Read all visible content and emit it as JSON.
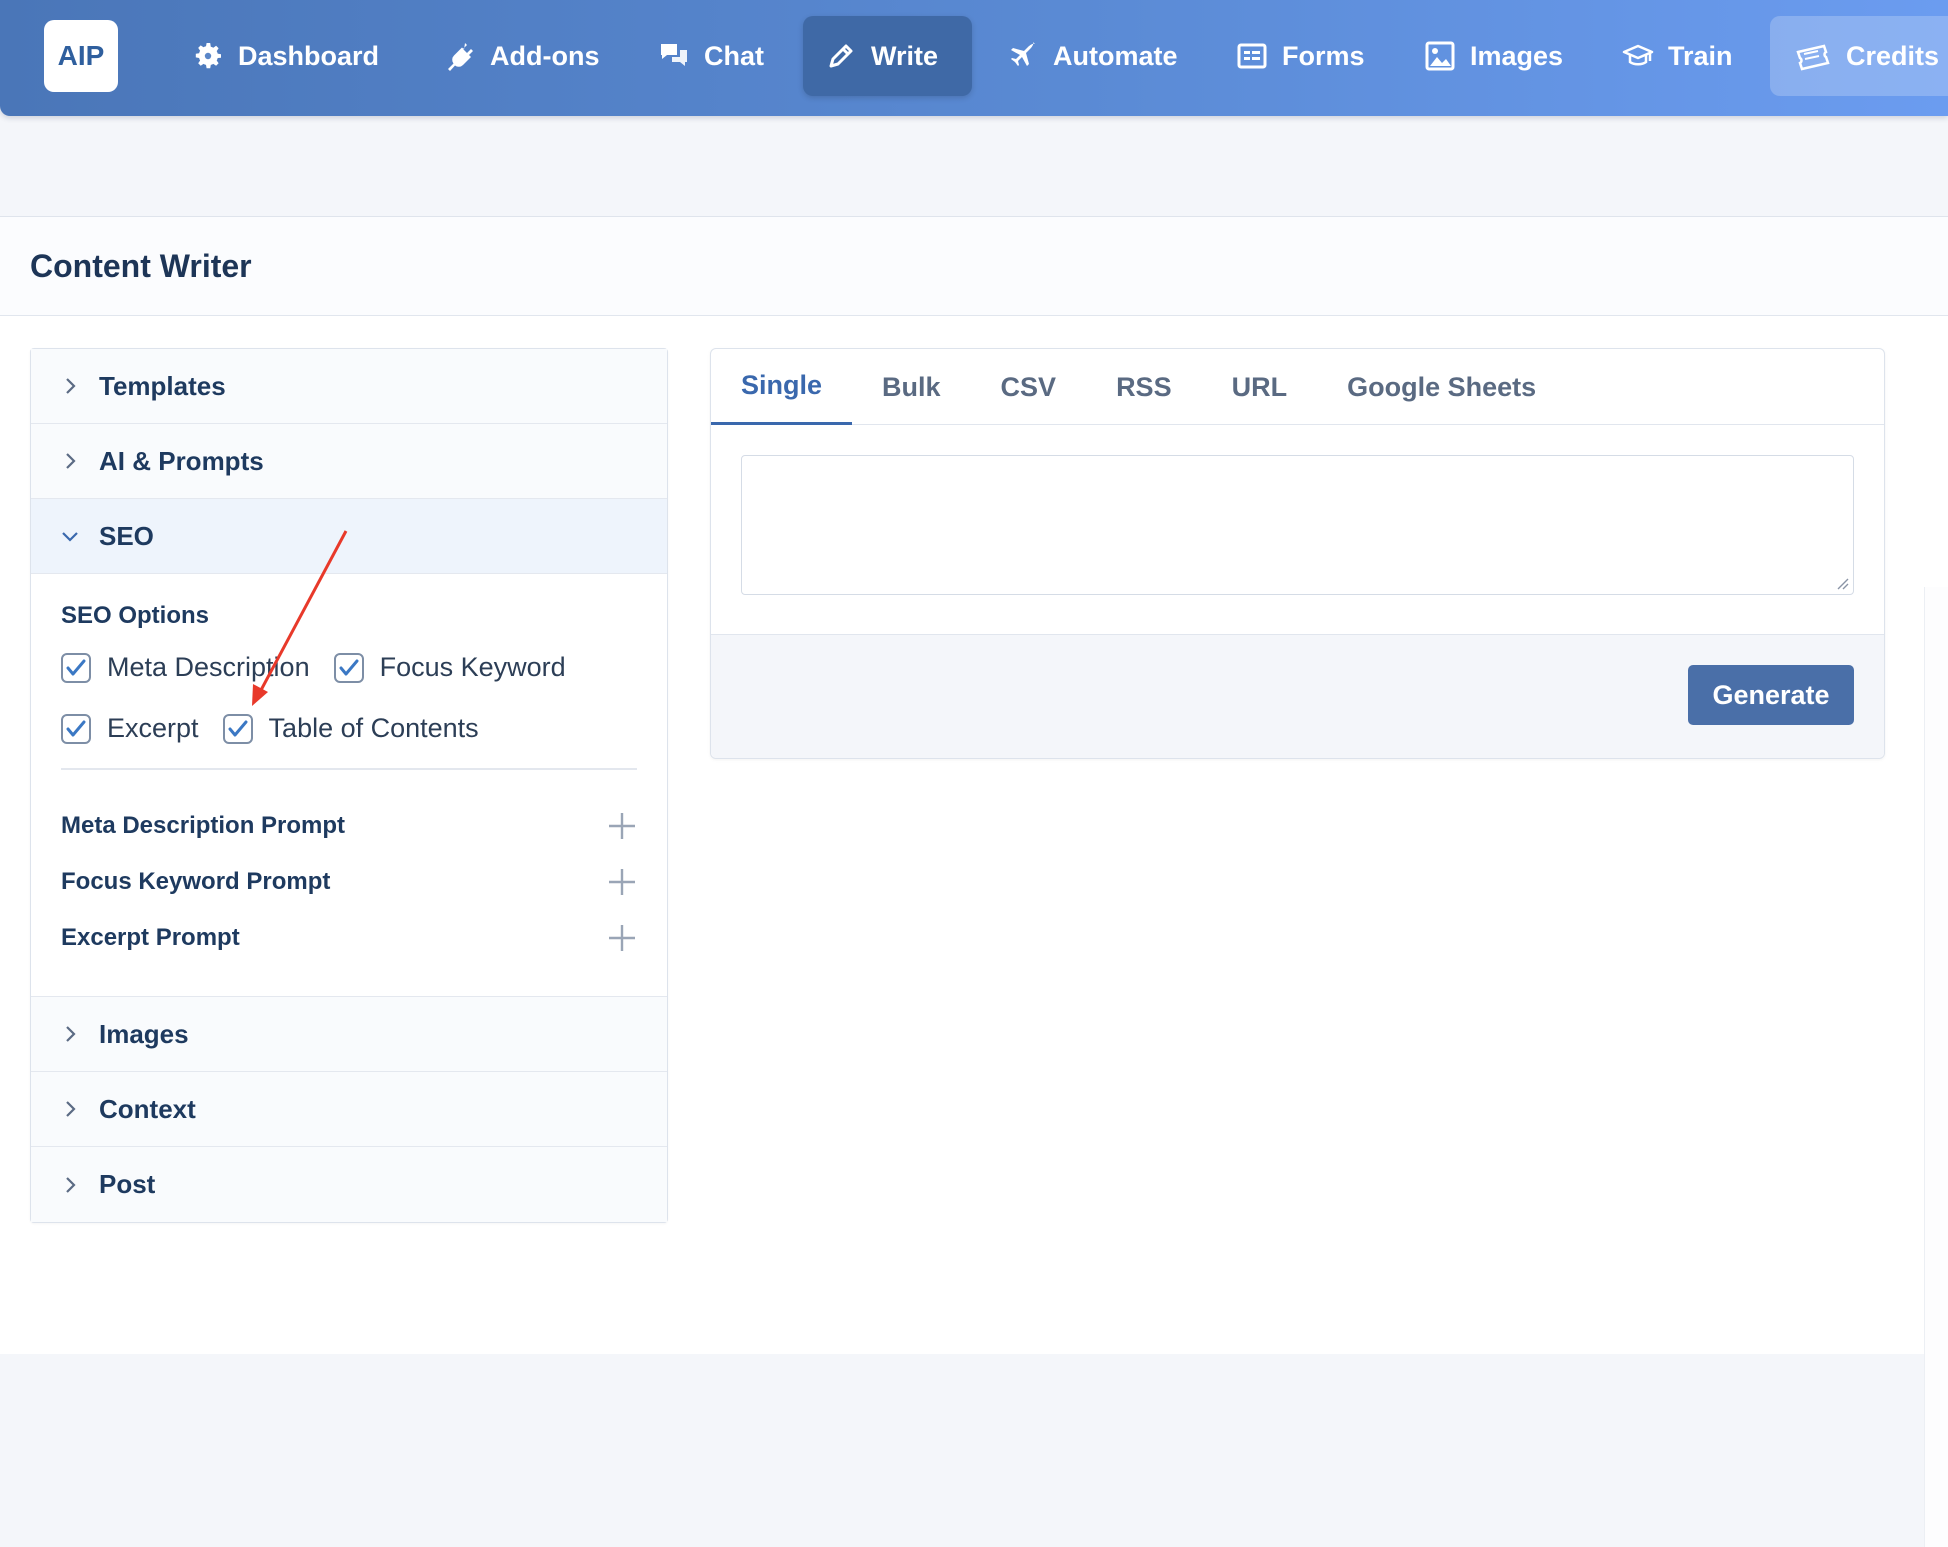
{
  "logo": "AIP",
  "nav": [
    {
      "label": "Dashboard",
      "icon": "gear-icon"
    },
    {
      "label": "Add-ons",
      "icon": "plug-icon"
    },
    {
      "label": "Chat",
      "icon": "chat-icon"
    },
    {
      "label": "Write",
      "icon": "pencil-icon",
      "active": true
    },
    {
      "label": "Automate",
      "icon": "plane-icon"
    },
    {
      "label": "Forms",
      "icon": "form-icon"
    },
    {
      "label": "Images",
      "icon": "image-icon"
    },
    {
      "label": "Train",
      "icon": "graduation-cap-icon"
    },
    {
      "label": "Credits",
      "icon": "tickets-icon"
    }
  ],
  "page": {
    "title": "Content Writer"
  },
  "accordion": {
    "sections": [
      {
        "label": "Templates",
        "open": false
      },
      {
        "label": "AI & Prompts",
        "open": false
      },
      {
        "label": "SEO",
        "open": true
      },
      {
        "label": "Images",
        "open": false
      },
      {
        "label": "Context",
        "open": false
      },
      {
        "label": "Post",
        "open": false
      }
    ],
    "seo": {
      "options_label": "SEO Options",
      "checkboxes": [
        {
          "label": "Meta Description",
          "checked": true
        },
        {
          "label": "Focus Keyword",
          "checked": true
        },
        {
          "label": "Excerpt",
          "checked": true
        },
        {
          "label": "Table of Contents",
          "checked": true
        }
      ],
      "prompts": [
        "Meta Description Prompt",
        "Focus Keyword Prompt",
        "Excerpt Prompt"
      ]
    }
  },
  "tabs": [
    {
      "label": "Single",
      "active": true
    },
    {
      "label": "Bulk"
    },
    {
      "label": "CSV"
    },
    {
      "label": "RSS"
    },
    {
      "label": "URL"
    },
    {
      "label": "Google Sheets"
    }
  ],
  "generate_label": "Generate",
  "colors": {
    "nav_gradient_start": "#4a76b8",
    "nav_gradient_end": "#6b9cf0",
    "accent": "#3a68ad",
    "checkbox_check": "#3b78c4",
    "annotation_arrow": "#e8392a"
  }
}
